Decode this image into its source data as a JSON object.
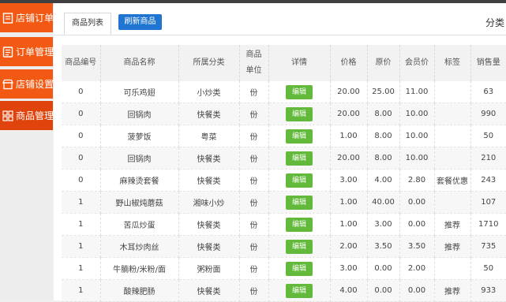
{
  "sidebar": {
    "items": [
      {
        "label": "店铺订单",
        "icon": "receipt-icon"
      },
      {
        "label": "订单管理",
        "icon": "order-list-icon"
      },
      {
        "label": "店铺设置",
        "icon": "store-icon"
      },
      {
        "label": "商品管理",
        "icon": "grid-icon"
      }
    ]
  },
  "toolbar": {
    "tab_label": "商品列表",
    "refresh_label": "刷新商品",
    "category_label": "分类"
  },
  "table": {
    "columns": [
      "商品编号",
      "商品名称",
      "所属分类",
      "商品单位",
      "详情",
      "价格",
      "原价",
      "会员价",
      "标签",
      "销售量"
    ],
    "edit_label": "编辑",
    "rows": [
      {
        "id": "0",
        "name": "可乐鸡翅",
        "category": "小炒类",
        "unit": "份",
        "price": "20.00",
        "original_price": "25.00",
        "member_price": "11.00",
        "tag": "",
        "sales": "63"
      },
      {
        "id": "0",
        "name": "回锅肉",
        "category": "快餐类",
        "unit": "份",
        "price": "20.00",
        "original_price": "8.00",
        "member_price": "10.00",
        "tag": "",
        "sales": "990"
      },
      {
        "id": "0",
        "name": "菠萝饭",
        "category": "粤菜",
        "unit": "份",
        "price": "1.00",
        "original_price": "8.00",
        "member_price": "10.00",
        "tag": "",
        "sales": "50"
      },
      {
        "id": "0",
        "name": "回锅肉",
        "category": "快餐类",
        "unit": "份",
        "price": "20.00",
        "original_price": "8.00",
        "member_price": "10.00",
        "tag": "",
        "sales": "210"
      },
      {
        "id": "0",
        "name": "麻辣烫套餐",
        "category": "快餐类",
        "unit": "份",
        "price": "3.00",
        "original_price": "4.00",
        "member_price": "2.80",
        "tag": "套餐优惠",
        "sales": "243"
      },
      {
        "id": "1",
        "name": "野山椒炖蘑菇",
        "category": "湘味小炒",
        "unit": "份",
        "price": "1.00",
        "original_price": "40.00",
        "member_price": "0.00",
        "tag": "",
        "sales": "107"
      },
      {
        "id": "1",
        "name": "苦瓜炒蛋",
        "category": "快餐类",
        "unit": "份",
        "price": "1.00",
        "original_price": "3.00",
        "member_price": "0.00",
        "tag": "推荐",
        "sales": "1710"
      },
      {
        "id": "1",
        "name": "木耳炒肉丝",
        "category": "快餐类",
        "unit": "份",
        "price": "2.00",
        "original_price": "3.50",
        "member_price": "3.50",
        "tag": "推荐",
        "sales": "735"
      },
      {
        "id": "1",
        "name": "牛腩粉/米粉/面",
        "category": "粥粉面",
        "unit": "份",
        "price": "3.00",
        "original_price": "0.00",
        "member_price": "2.00",
        "tag": "",
        "sales": "50"
      },
      {
        "id": "1",
        "name": "酸辣肥肠",
        "category": "快餐类",
        "unit": "份",
        "price": "4.00",
        "original_price": "0.00",
        "member_price": "0.00",
        "tag": "推荐",
        "sales": "933"
      }
    ]
  },
  "colors": {
    "sidebar_bg": "#f25a14",
    "sidebar_active": "#e0430b",
    "refresh_button": "#1f75d1",
    "edit_button": "#63b93a"
  }
}
